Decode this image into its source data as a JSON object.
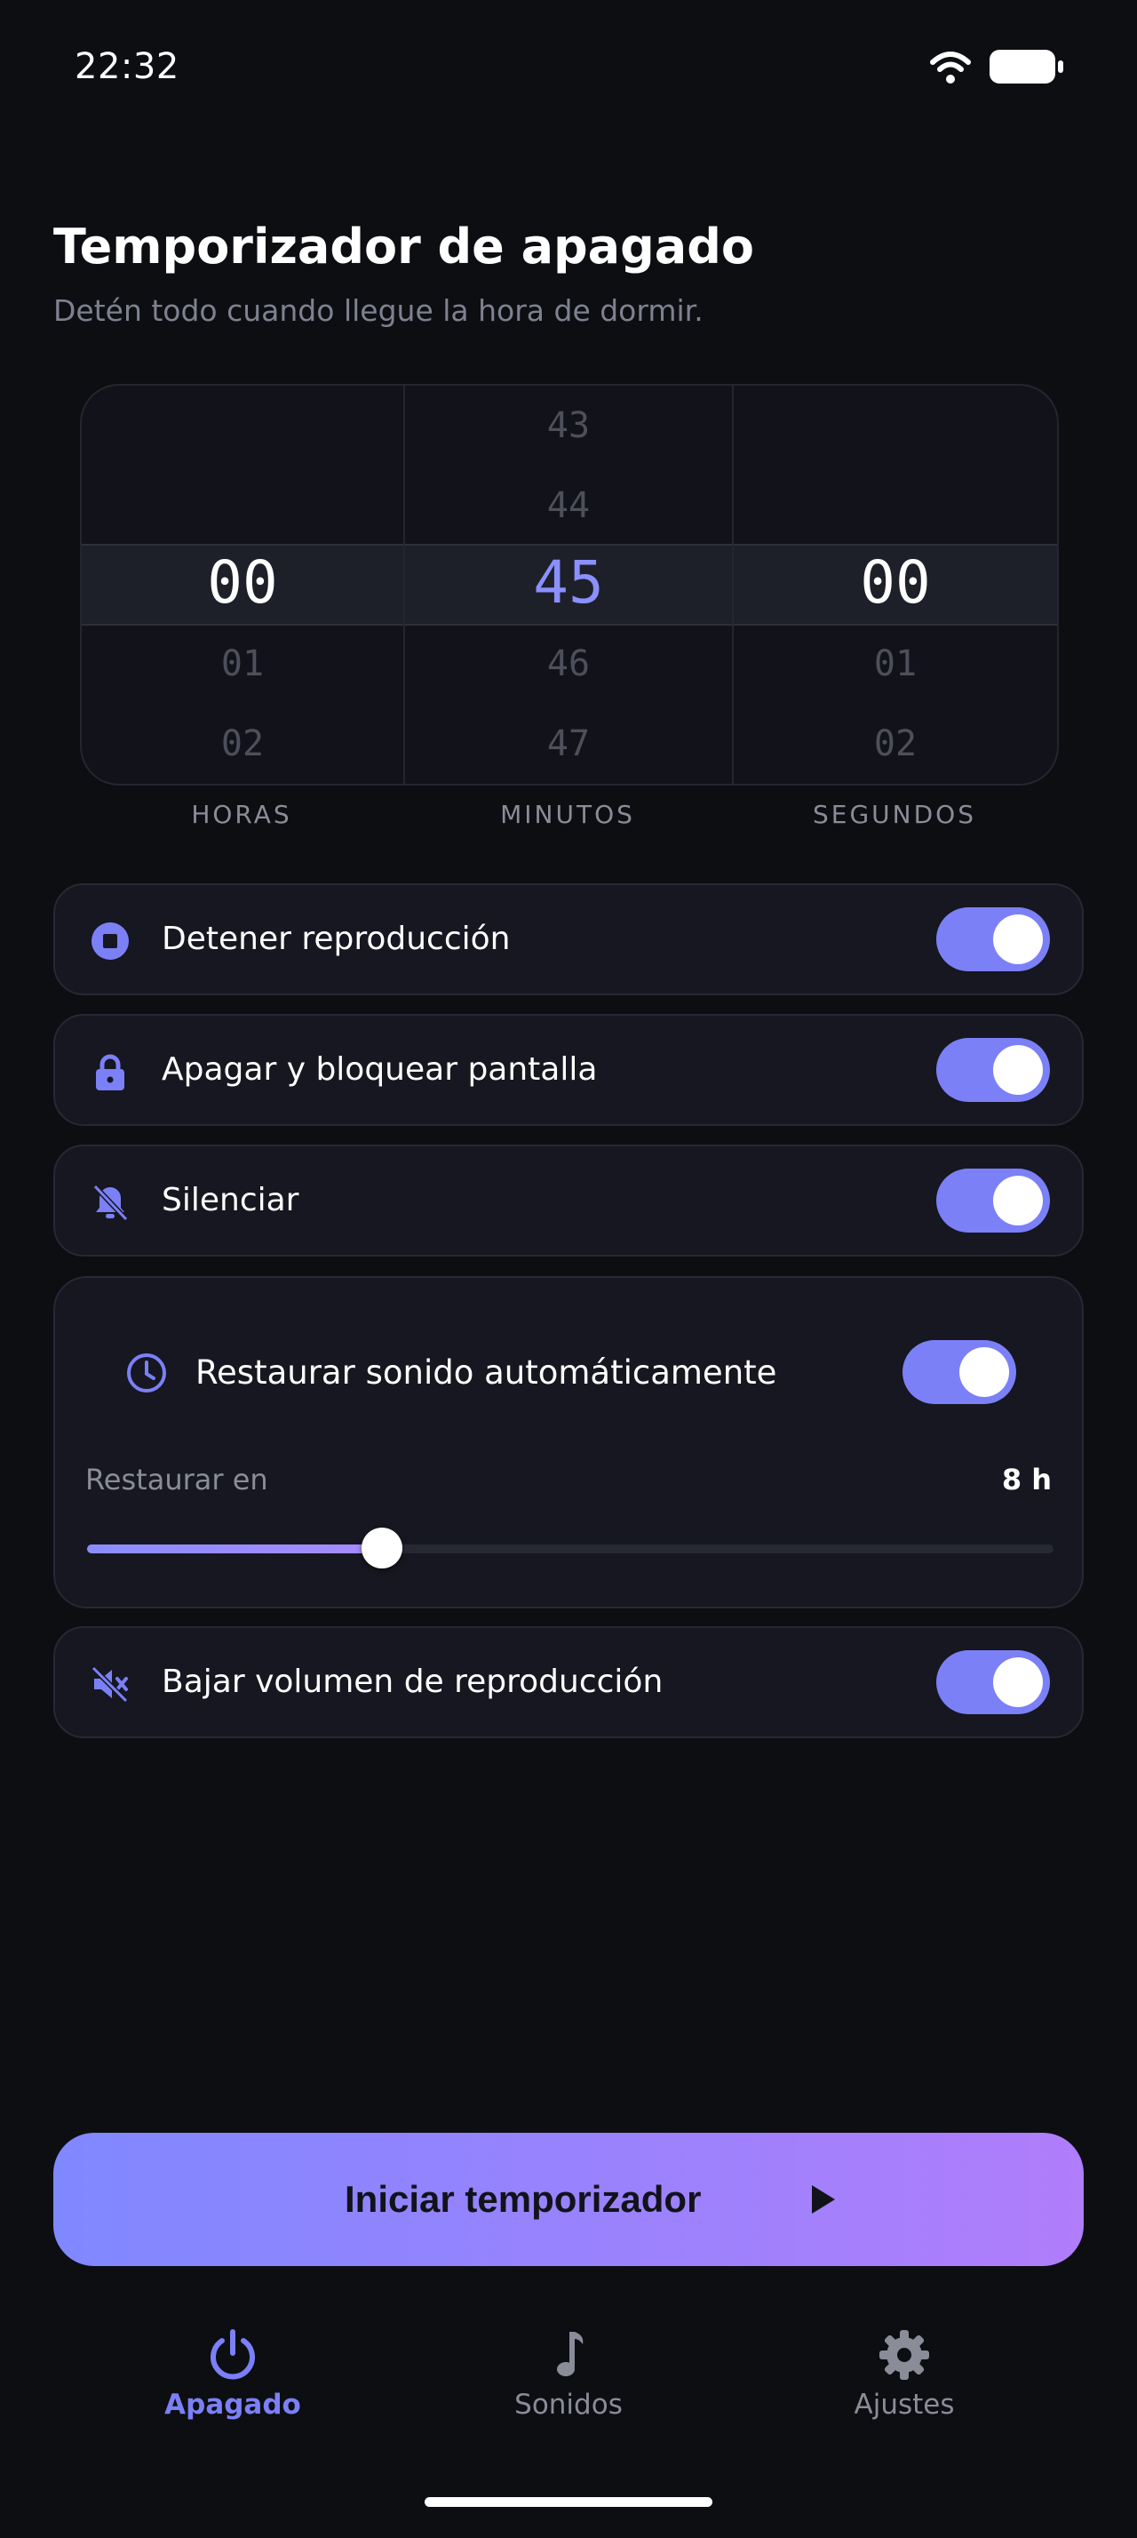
{
  "status_bar": {
    "time": "22:32"
  },
  "header": {
    "title": "Temporizador de apagado",
    "subtitle": "Detén todo cuando llegue la hora de dormir."
  },
  "picker": {
    "hours": {
      "above": [
        "",
        ""
      ],
      "selected": "00",
      "below": [
        "01",
        "02"
      ],
      "label": "HORAS"
    },
    "minutes": {
      "above": [
        "43",
        "44"
      ],
      "selected": "45",
      "below": [
        "46",
        "47"
      ],
      "label": "MINUTOS"
    },
    "seconds": {
      "above": [
        "",
        ""
      ],
      "selected": "00",
      "below": [
        "01",
        "02"
      ],
      "label": "SEGUNDOS"
    }
  },
  "options": [
    {
      "label": "Detener reproducción",
      "icon": "stop-circle-icon",
      "enabled": true
    },
    {
      "label": "Apagar y bloquear pantalla",
      "icon": "lock-icon",
      "enabled": true
    },
    {
      "label": "Silenciar",
      "icon": "bell-off-icon",
      "enabled": true
    }
  ],
  "restore": {
    "label": "Restaurar sonido automáticamente",
    "icon": "clock-icon",
    "enabled": true,
    "restore_in_label": "Restaurar en",
    "value_text": "8 h",
    "slider_fraction": 0.305
  },
  "lower_volume": {
    "label": "Bajar volumen de reproducción",
    "icon": "volume-mute-icon",
    "enabled": true
  },
  "start_button": {
    "label": "Iniciar temporizador",
    "icon": "play-icon"
  },
  "tabs": [
    {
      "label": "Apagado",
      "icon": "power-icon",
      "active": true
    },
    {
      "label": "Sonidos",
      "icon": "music-note-icon",
      "active": false
    },
    {
      "label": "Ajustes",
      "icon": "gear-icon",
      "active": false
    }
  ],
  "colors": {
    "accent": "#7b80f7",
    "background": "#0d0e12",
    "card": "#161720",
    "tab_inactive": "#8a8c98",
    "button_gradient_start": "#8088ff",
    "button_gradient_end": "#b07dfb"
  }
}
